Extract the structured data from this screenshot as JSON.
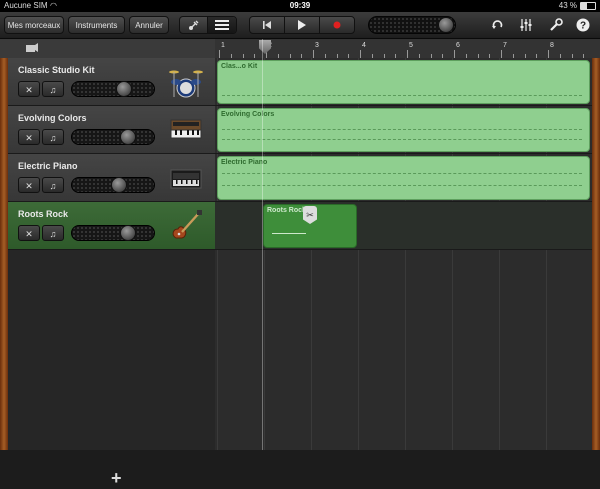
{
  "status": {
    "carrier": "Aucune SIM",
    "time": "09:39",
    "battery": "43 %"
  },
  "toolbar": {
    "my_songs": "Mes morceaux",
    "instruments": "Instruments",
    "undo": "Annuler",
    "view_icons": [
      "guitar-view-icon",
      "tracks-view-icon"
    ],
    "transport_icons": [
      "go-to-start-icon",
      "play-icon",
      "record-icon"
    ],
    "volume_level": 0.85,
    "right_icons": [
      "loop-icon",
      "mixer-icon",
      "settings-wrench-icon",
      "help-icon"
    ]
  },
  "ruler": {
    "bars": [
      "1",
      "2",
      "3",
      "4",
      "5",
      "6",
      "7",
      "8"
    ]
  },
  "tracks": [
    {
      "name": "Classic Studio Kit",
      "instrument": "drum-kit-icon",
      "volume": 0.65,
      "selected": false
    },
    {
      "name": "Evolving Colors",
      "instrument": "synthesizer-icon",
      "volume": 0.7,
      "selected": false
    },
    {
      "name": "Electric Piano",
      "instrument": "electric-piano-icon",
      "volume": 0.6,
      "selected": false
    },
    {
      "name": "Roots Rock",
      "instrument": "electric-guitar-icon",
      "volume": 0.7,
      "selected": true
    }
  ],
  "regions": {
    "track1": "Clas...o Kit",
    "track2": "Evolving Colors",
    "track3": "Electric Piano",
    "track4": "Roots Rock"
  },
  "add_track": "+",
  "colors": {
    "region": "#8fcf8f",
    "region_selected": "#3e8e3a",
    "record": "#e02020",
    "wood": "#a65e25"
  }
}
